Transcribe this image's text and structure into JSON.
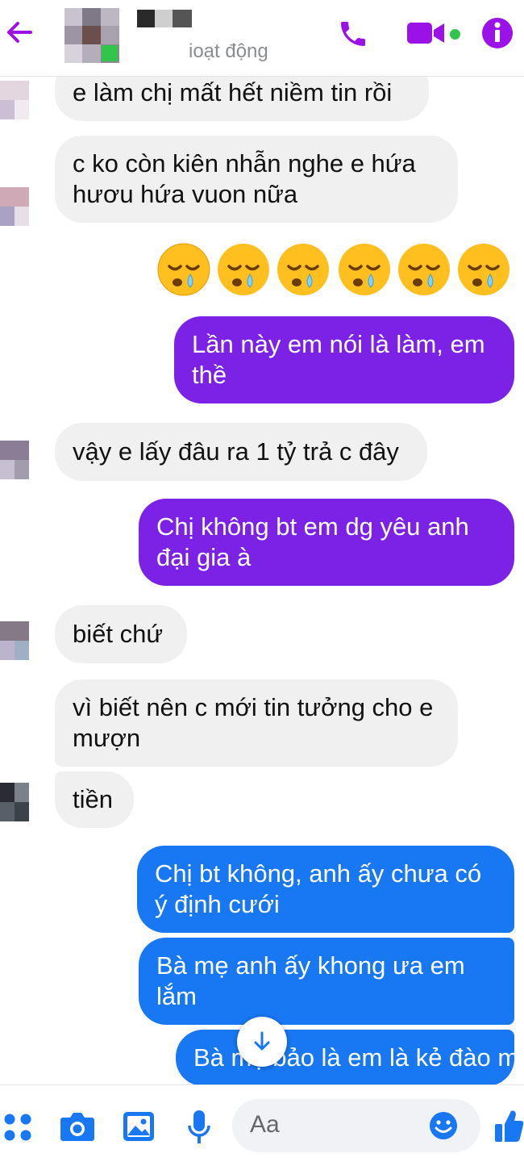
{
  "header": {
    "status_text": "ioạt động",
    "colors": {
      "accent": "#9b12e8"
    }
  },
  "messages": [
    {
      "text": "e làm chị mất hết niềm tin rồi",
      "side": "incoming"
    },
    {
      "text": "c ko còn kiên nhẫn nghe e hứa hươu hứa vuon nữa",
      "side": "incoming"
    },
    {
      "emoji": "sleepy-face-emoji",
      "count": 6,
      "side": "outgoing"
    },
    {
      "text": "Lần này em nói là làm, em thề",
      "side": "outgoing"
    },
    {
      "text": "vậy e lấy đâu ra 1 tỷ trả c đây",
      "side": "incoming"
    },
    {
      "text": "Chị không bt em dg yêu anh đại gia à",
      "side": "outgoing"
    },
    {
      "text": "biết chứ",
      "side": "incoming"
    },
    {
      "text": "vì biết nên c mới tin tưởng cho e mượn",
      "side": "incoming"
    },
    {
      "text": "tiền",
      "side": "incoming"
    },
    {
      "text": "Chị bt không, anh ấy chưa có ý định cưới",
      "side": "outgoing"
    },
    {
      "text": "Bà mẹ anh ấy khong ưa em lắm",
      "side": "outgoing"
    },
    {
      "text": "Bà mẹ bảo là em là kẻ đào mỏ",
      "side": "outgoing",
      "partially_hidden": true
    }
  ],
  "composer": {
    "placeholder": "Aa",
    "colors": {
      "icons": "#1877f2"
    }
  }
}
